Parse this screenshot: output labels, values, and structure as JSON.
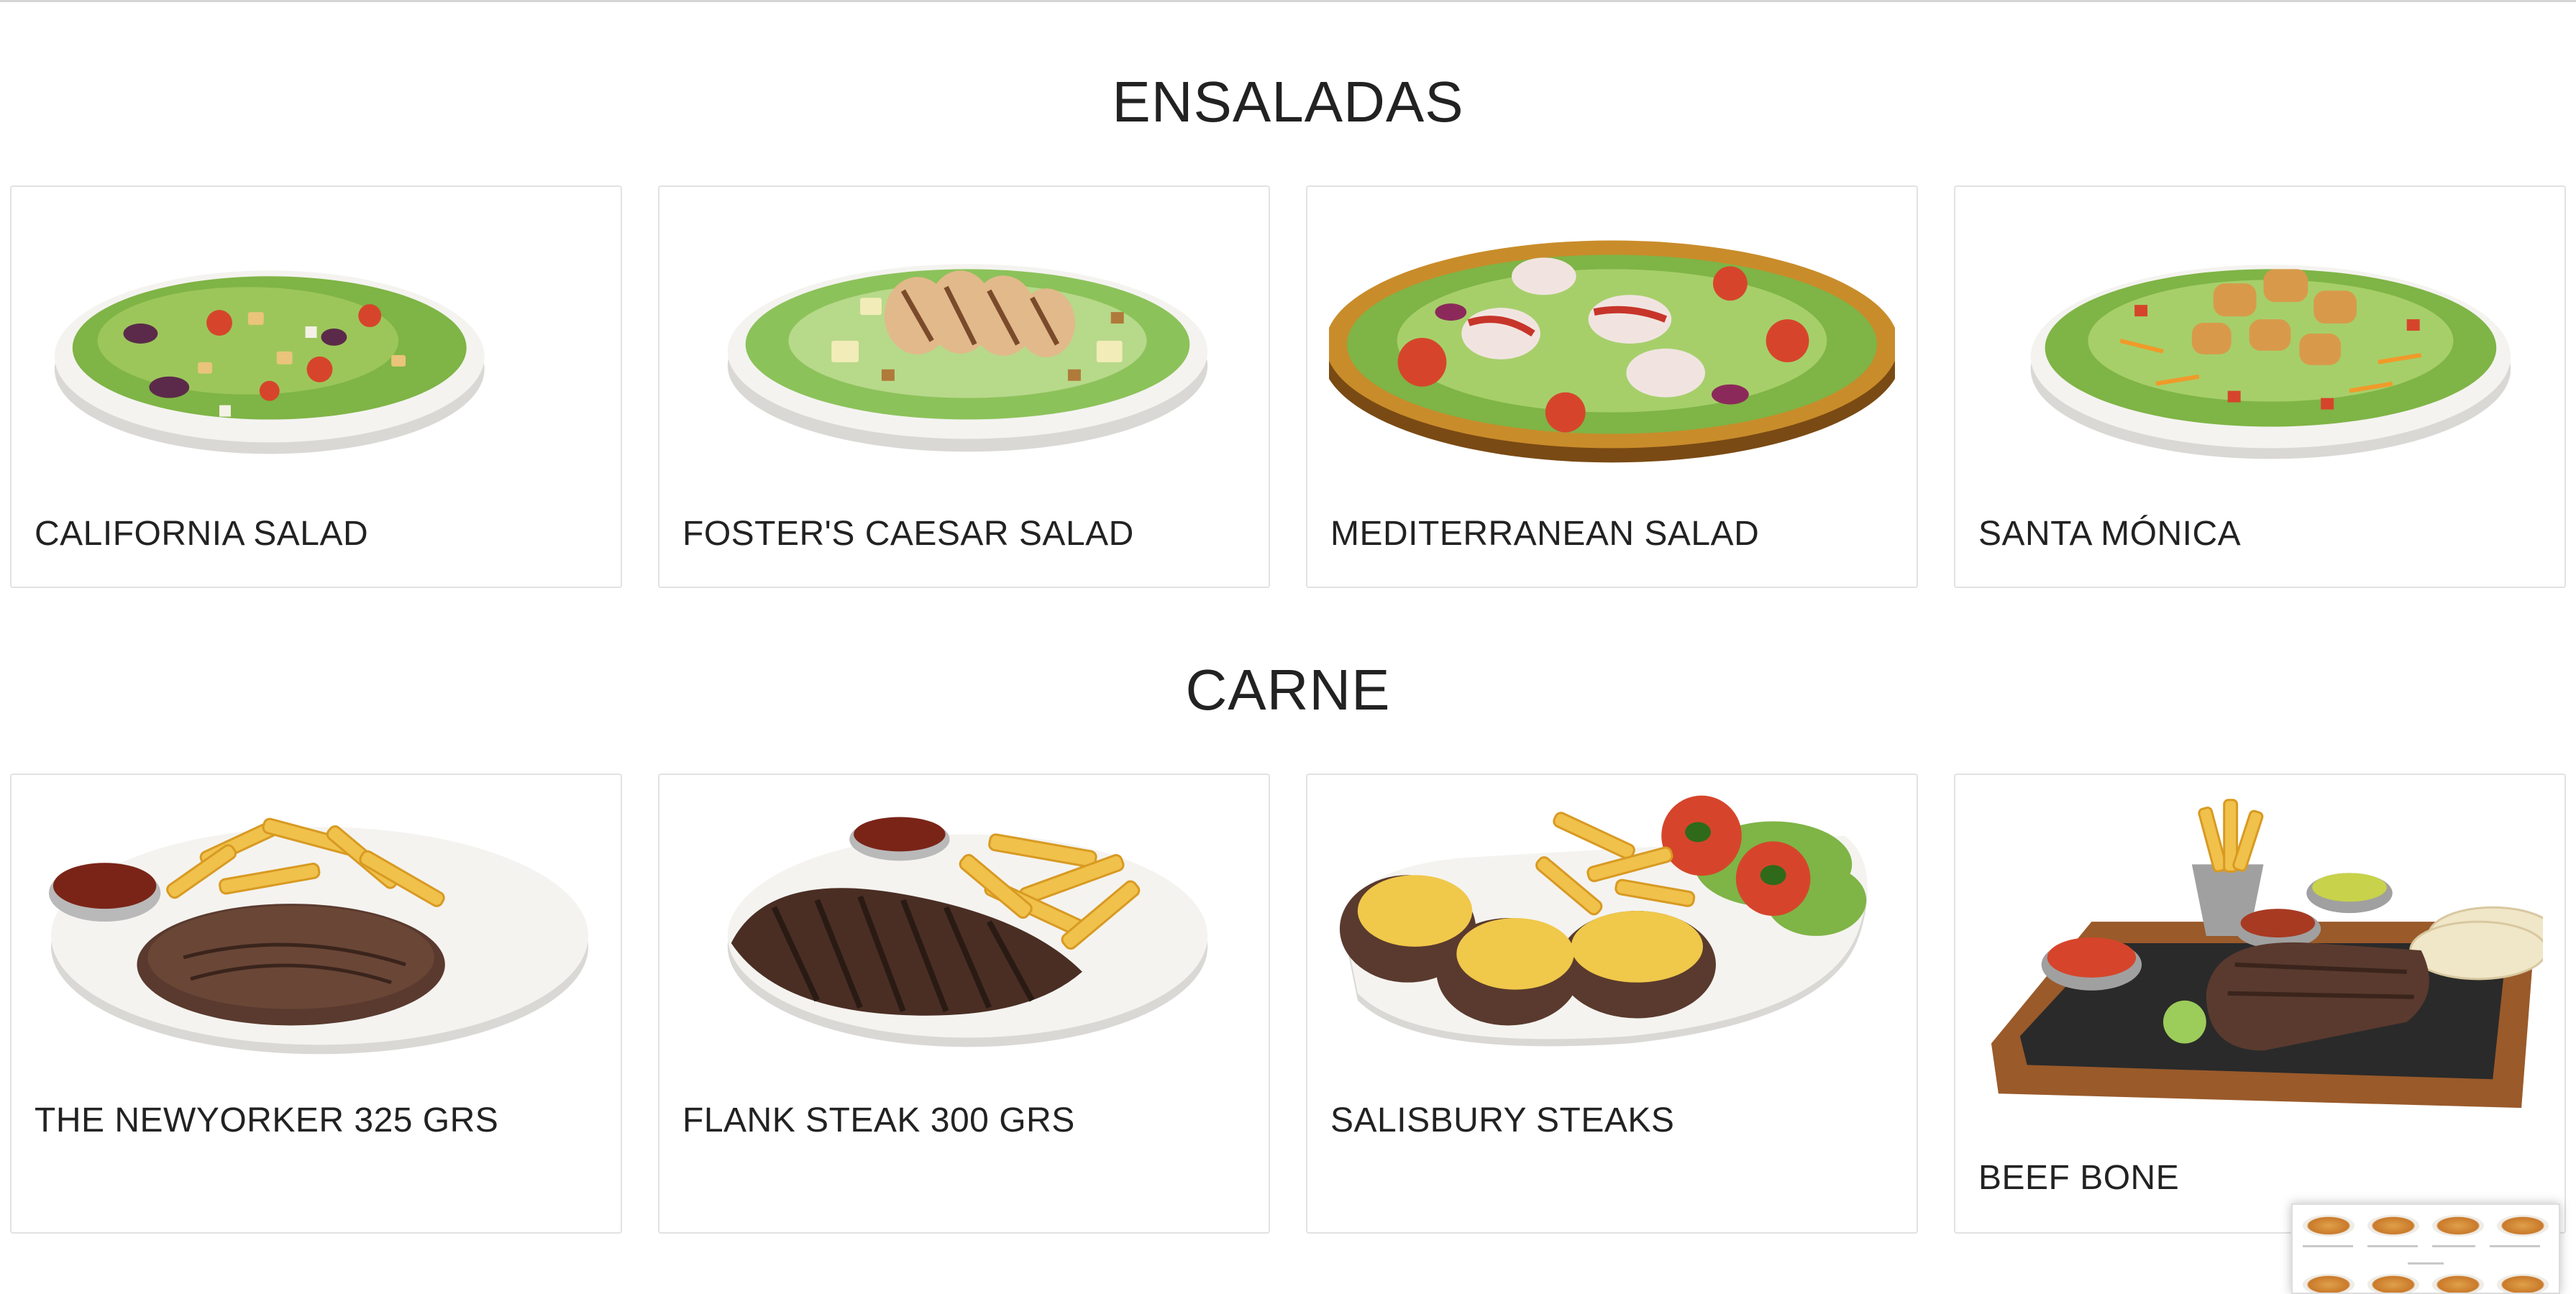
{
  "sections": [
    {
      "title": "ENSALADAS",
      "items": [
        {
          "name": "CALIFORNIA SALAD",
          "icon": "salad-bowl-image"
        },
        {
          "name": "FOSTER'S CAESAR SALAD",
          "icon": "caesar-salad-image"
        },
        {
          "name": "MEDITERRANEAN SALAD",
          "icon": "mediterranean-salad-image"
        },
        {
          "name": "SANTA MÓNICA",
          "icon": "chicken-salad-image"
        }
      ]
    },
    {
      "title": "CARNE",
      "items": [
        {
          "name": "THE NEWYORKER 325 GRS",
          "icon": "steak-fries-image"
        },
        {
          "name": "FLANK STEAK 300 GRS",
          "icon": "flank-steak-image"
        },
        {
          "name": "SALISBURY STEAKS",
          "icon": "salisbury-steak-image"
        },
        {
          "name": "BEEF BONE",
          "icon": "beef-bone-board-image"
        }
      ]
    }
  ],
  "colors": {
    "lettuce": "#7fb446",
    "lettuce_dark": "#4f8a2a",
    "tomato": "#d6452b",
    "plate": "#f3f2ef",
    "steak": "#5a3a2e",
    "fries": "#f0c14b",
    "cheese": "#f0c84a",
    "board": "#9a5a2a",
    "slate": "#2a2a2a"
  }
}
